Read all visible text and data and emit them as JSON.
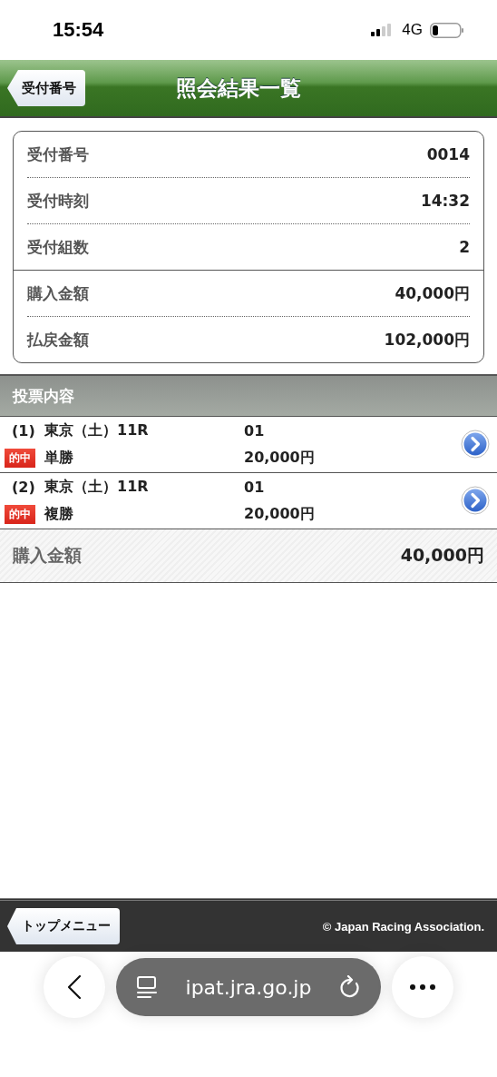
{
  "status_bar": {
    "time": "15:54",
    "network": "4G"
  },
  "header": {
    "back_button": "受付番号",
    "title": "照会結果一覧"
  },
  "summary": {
    "groups": [
      [
        {
          "label": "受付番号",
          "value": "0014"
        },
        {
          "label": "受付時刻",
          "value": "14:32"
        },
        {
          "label": "受付組数",
          "value": "2"
        }
      ],
      [
        {
          "label": "購入金額",
          "value": "40,000円"
        },
        {
          "label": "払戻金額",
          "value": "102,000円"
        }
      ]
    ]
  },
  "section_title": "投票内容",
  "bets": [
    {
      "number": "(1)",
      "race": "東京（土）11R",
      "hit": true,
      "hit_label": "的中",
      "bet_type": "単勝",
      "selection": "01",
      "amount": "20,000円"
    },
    {
      "number": "(2)",
      "race": "東京（土）11R",
      "hit": true,
      "hit_label": "的中",
      "bet_type": "複勝",
      "selection": "01",
      "amount": "20,000円"
    }
  ],
  "total": {
    "label": "購入金額",
    "value": "40,000円"
  },
  "footer": {
    "top_menu_button": "トップメニュー",
    "copyright": "© Japan Racing Association."
  },
  "browser_bar": {
    "url": "ipat.jra.go.jp"
  }
}
